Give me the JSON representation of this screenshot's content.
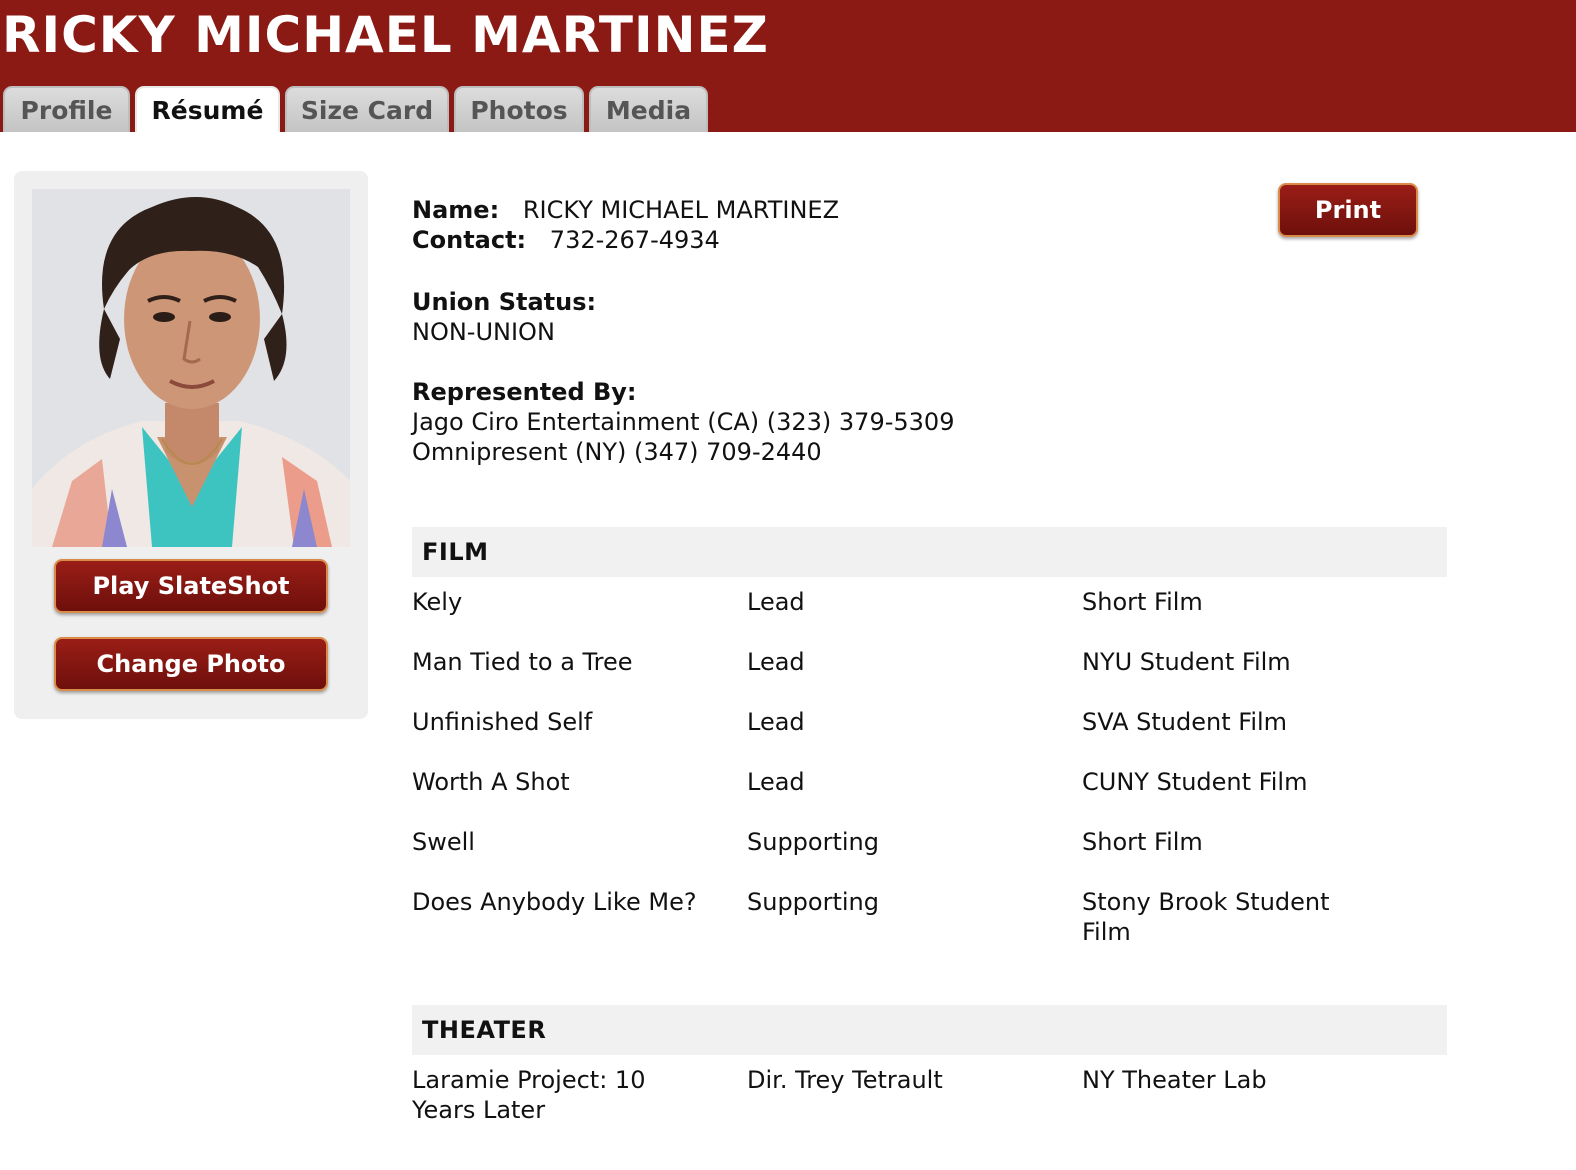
{
  "header": {
    "actor_name": "RICKY MICHAEL MARTINEZ",
    "background_color": "#8b1a14"
  },
  "tabs": [
    {
      "label": "Profile",
      "active": false
    },
    {
      "label": "Résumé",
      "active": true
    },
    {
      "label": "Size Card",
      "active": false
    },
    {
      "label": "Photos",
      "active": false
    },
    {
      "label": "Media",
      "active": false
    }
  ],
  "sidebar": {
    "play_slateshot_label": "Play SlateShot",
    "change_photo_label": "Change Photo"
  },
  "resume": {
    "print_label": "Print",
    "name_label": "Name:",
    "name_value": "RICKY MICHAEL MARTINEZ",
    "contact_label": "Contact:",
    "contact_value": "732-267-4934",
    "union_label": "Union Status:",
    "union_value": "NON-UNION",
    "represented_label": "Represented By:",
    "representation": [
      "Jago Ciro Entertainment (CA) (323) 379-5309",
      "Omnipresent (NY) (347) 709-2440"
    ]
  },
  "sections": [
    {
      "title": "FILM",
      "credits": [
        {
          "project": "Kely",
          "role": "Lead",
          "company": "Short Film"
        },
        {
          "project": "Man Tied to a Tree",
          "role": "Lead",
          "company": "NYU Student Film"
        },
        {
          "project": "Unfinished Self",
          "role": "Lead",
          "company": "SVA Student Film"
        },
        {
          "project": "Worth A Shot",
          "role": "Lead",
          "company": "CUNY Student Film"
        },
        {
          "project": "Swell",
          "role": "Supporting",
          "company": "Short Film"
        },
        {
          "project": "Does Anybody Like Me?",
          "role": "Supporting",
          "company": "Stony Brook Student Film"
        }
      ]
    },
    {
      "title": "THEATER",
      "credits": [
        {
          "project": "Laramie Project: 10 Years Later",
          "role": "Dir. Trey Tetrault",
          "company": "NY Theater Lab"
        }
      ]
    }
  ]
}
